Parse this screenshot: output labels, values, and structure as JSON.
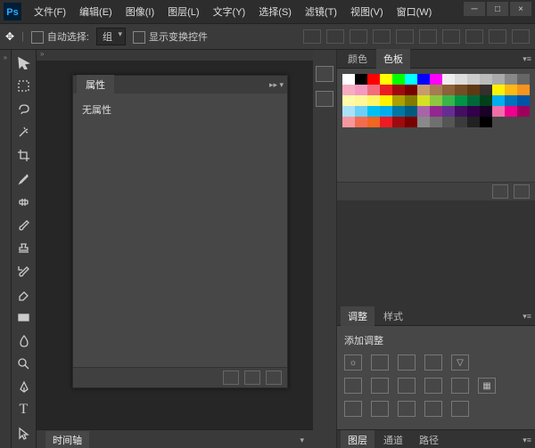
{
  "app": {
    "logo": "Ps"
  },
  "menubar": {
    "items": [
      {
        "label": "文件(F)"
      },
      {
        "label": "编辑(E)"
      },
      {
        "label": "图像(I)"
      },
      {
        "label": "图层(L)"
      },
      {
        "label": "文字(Y)"
      },
      {
        "label": "选择(S)"
      },
      {
        "label": "滤镜(T)"
      },
      {
        "label": "视图(V)"
      },
      {
        "label": "窗口(W)"
      }
    ]
  },
  "window_controls": {
    "min": "─",
    "max": "□",
    "close": "×"
  },
  "optionbar": {
    "auto_select_label": "自动选择:",
    "group_label": "组",
    "show_transform_label": "显示变换控件"
  },
  "tools": [
    {
      "name": "move-tool"
    },
    {
      "name": "marquee-tool"
    },
    {
      "name": "lasso-tool"
    },
    {
      "name": "wand-tool"
    },
    {
      "name": "crop-tool"
    },
    {
      "name": "eyedropper-tool"
    },
    {
      "name": "heal-tool"
    },
    {
      "name": "brush-tool"
    },
    {
      "name": "stamp-tool"
    },
    {
      "name": "history-brush-tool"
    },
    {
      "name": "eraser-tool"
    },
    {
      "name": "gradient-tool"
    },
    {
      "name": "blur-tool"
    },
    {
      "name": "dodge-tool"
    },
    {
      "name": "pen-tool"
    },
    {
      "name": "type-tool"
    },
    {
      "name": "path-select-tool"
    }
  ],
  "properties_panel": {
    "tab": "属性",
    "empty_text": "无属性"
  },
  "timeline_panel": {
    "tab": "时间轴"
  },
  "color_panel": {
    "tabs": [
      {
        "label": "颜色"
      },
      {
        "label": "色板"
      }
    ],
    "swatches": [
      "#ffffff",
      "#000000",
      "#ff0000",
      "#ffff00",
      "#00ff00",
      "#00ffff",
      "#0000ff",
      "#ff00ff",
      "#eeeeee",
      "#dddddd",
      "#cccccc",
      "#bbbbbb",
      "#aaaaaa",
      "#888888",
      "#666666",
      "#f7adc1",
      "#f49ac1",
      "#f26d7d",
      "#ed1c24",
      "#9e0b0f",
      "#790000",
      "#c69c6d",
      "#a67c52",
      "#8c6239",
      "#754c24",
      "#603913",
      "#362f2d",
      "#fff200",
      "#fdb913",
      "#f7941d",
      "#fffbaa",
      "#fff799",
      "#fff568",
      "#fff200",
      "#aba000",
      "#827b00",
      "#d7df23",
      "#8dc63f",
      "#39b54a",
      "#009444",
      "#006838",
      "#00401a",
      "#00aeef",
      "#0072bc",
      "#0054a6",
      "#aae1f9",
      "#6dcff6",
      "#00bff3",
      "#00aeef",
      "#0076a3",
      "#005b7f",
      "#a864a8",
      "#92278f",
      "#662d91",
      "#440e62",
      "#32004b",
      "#1b0027",
      "#f06eaa",
      "#ed008c",
      "#9e005d",
      "#f5989d",
      "#f26c4f",
      "#f26522",
      "#ed1c24",
      "#9e0b0f",
      "#790000",
      "#898989",
      "#707070",
      "#555555",
      "#3b3b3b",
      "#212121",
      "#000000"
    ]
  },
  "adjust_panel": {
    "tabs": [
      {
        "label": "调整"
      },
      {
        "label": "样式"
      }
    ],
    "title": "添加调整"
  },
  "bottom_tabs": {
    "items": [
      {
        "label": "图层"
      },
      {
        "label": "通道"
      },
      {
        "label": "路径"
      }
    ]
  }
}
